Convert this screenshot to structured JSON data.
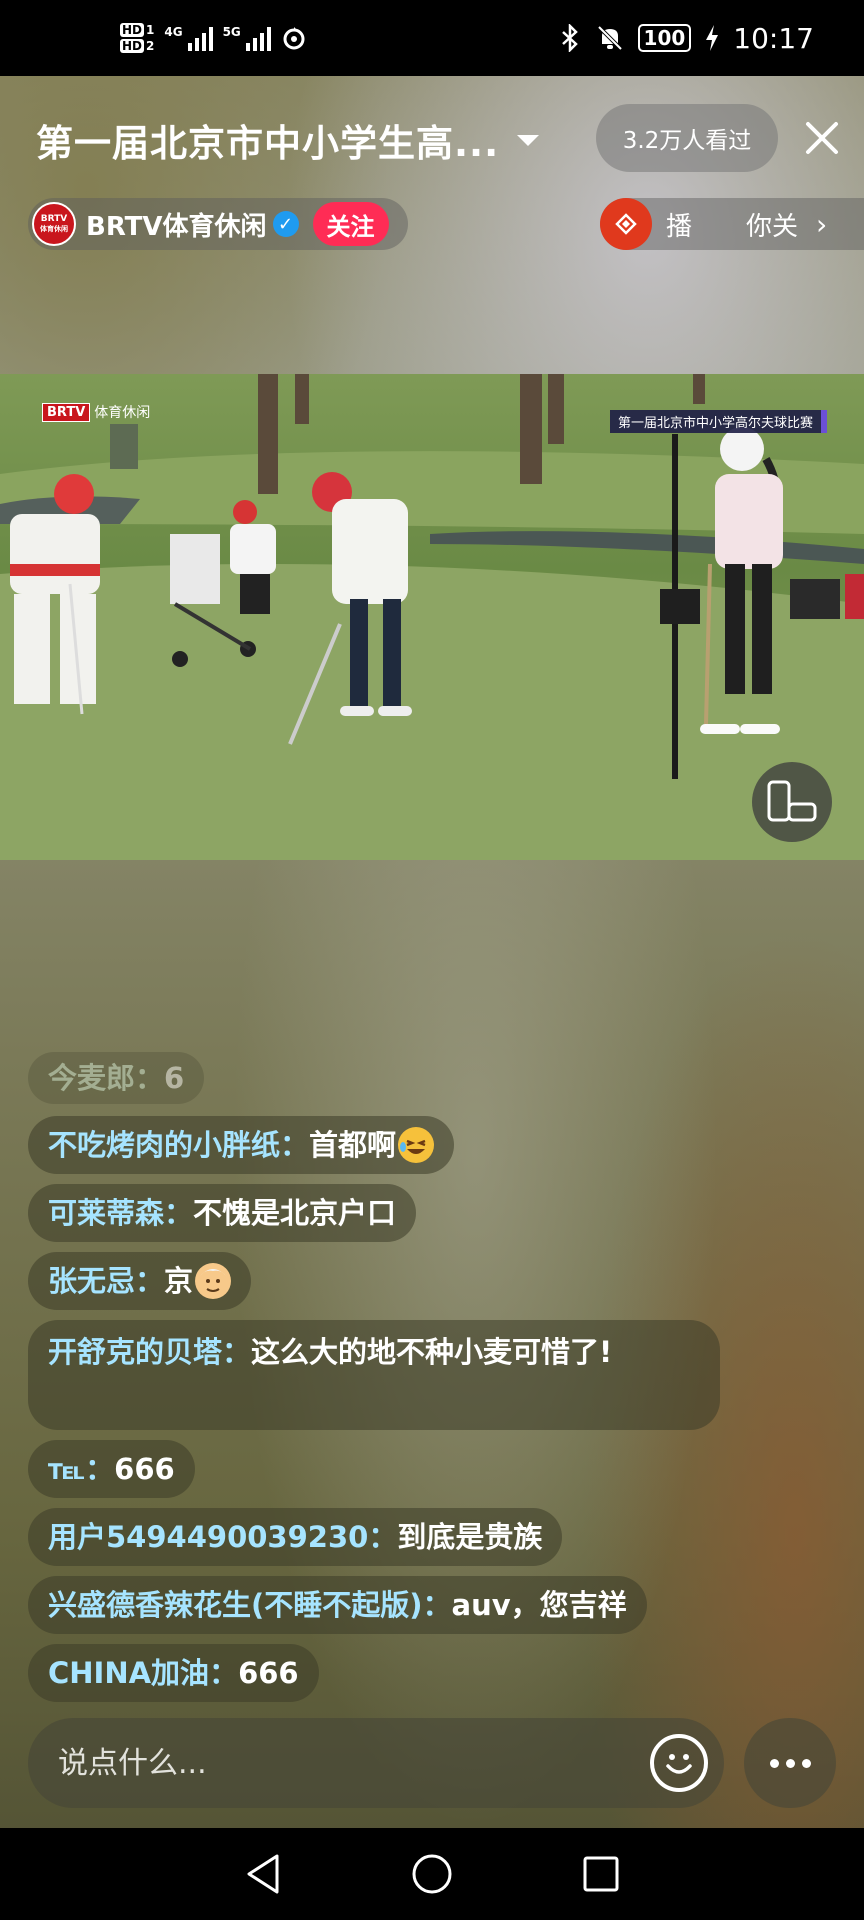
{
  "status_bar": {
    "hd1": "HD",
    "hd1_sub": "1",
    "hd2": "HD",
    "hd2_sub": "2",
    "net1": "4G",
    "net2": "5G",
    "battery": "100",
    "time": "10:17",
    "icons": [
      "bluetooth-icon",
      "mute-bell-icon",
      "charging-icon",
      "data-saver-icon"
    ]
  },
  "header": {
    "title": "第一届北京市中小学生高...",
    "viewers": "3.2万人看过",
    "close_icon": "close-icon"
  },
  "anchor": {
    "logo_text": "BRTV",
    "logo_sub": "体育休闲",
    "name": "BRTV体育休闲",
    "follow_label": "关注"
  },
  "recommend": {
    "label1": "播",
    "label2": "你关"
  },
  "video": {
    "watermark_logo": "BRTV",
    "watermark_text": "体育休闲",
    "caption": "第一届北京市中小学高尔夫球比赛"
  },
  "chat": {
    "messages": [
      {
        "user": "今麦郎：",
        "text": "6"
      },
      {
        "user": "不吃烤肉的小胖纸：",
        "text": "首都啊",
        "emoji": "laughing-emoji"
      },
      {
        "user": "可莱蒂森：",
        "text": "不愧是北京户口"
      },
      {
        "user": "张无忌：",
        "text": "京",
        "emoji": "old-man-emoji"
      },
      {
        "user": "开舒克的贝塔：",
        "text": "这么大的地不种小麦可惜了!"
      },
      {
        "user": "℡：",
        "text": "666"
      },
      {
        "user": "用户5494490039230：",
        "text": "到底是贵族"
      },
      {
        "user": "兴盛德香辣花生(不睡不起版)：",
        "text": "auv，您吉祥"
      },
      {
        "user": "CHINA加油：",
        "text": "666"
      }
    ]
  },
  "input": {
    "placeholder": "说点什么..."
  }
}
